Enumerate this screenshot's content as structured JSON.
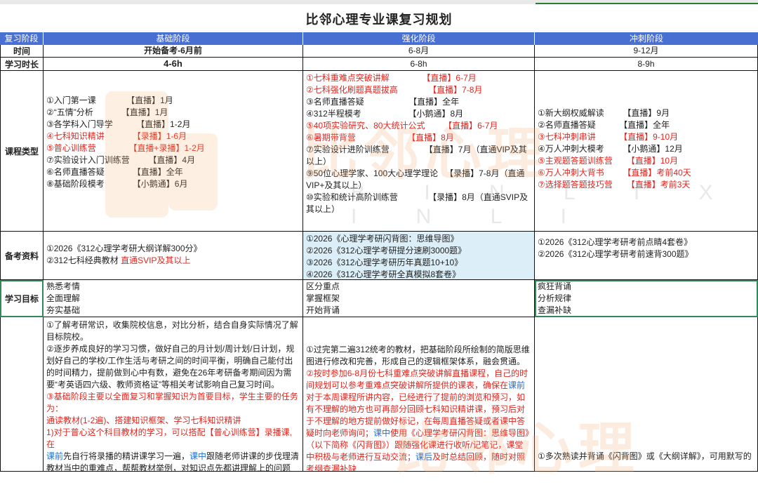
{
  "title": "比邻心理专业课复习规划",
  "headers": [
    "复习阶段",
    "基础阶段",
    "强化阶段",
    "冲刺阶段"
  ],
  "time_row": {
    "label": "时间",
    "values": [
      "开始备考-6月前",
      "6-8月",
      "9-12月"
    ]
  },
  "duration_row": {
    "label": "学习时长",
    "values": [
      "4-6h",
      "6-8h",
      "8-9h"
    ]
  },
  "course_row": {
    "label": "课程类型",
    "basic": [
      "①入门第一课             【直播】1月",
      "②“五情”分析            【直播】1月",
      "③各学科入门导学          【直播】1-2月",
      "④七科知识精讲            【录播】1-6月",
      "⑤普心训练营              【直播+录播】1-2月",
      "⑦实验设计入门训练营        【直播】4月",
      "⑥名师直播答疑            【直播】全年",
      "⑧基础阶段模考            【小鹅通】6月"
    ],
    "strengthen": [
      "①七科重难点突破讲解              【直播】6-7月",
      "②七科强化刷题真题拔高             【直播】7-8月",
      "③名师直播答疑                   【直播】全年",
      "④312半程模考                    【小鹅通】8月",
      "⑤40项实验研究、80大统计公式        【直播】6-7月",
      "⑥暑期带背营                      【直播】8月",
      "⑦实验设计进阶训练营               【直播】7月（直通VIP及其",
      "以上）",
      "⑨50位心理学家、100大心理学理论   【录播】7-8月（直通",
      "VIP+及其以上）",
      "⑩实验和统计高阶训练营             【录播】8月（直通SVIP及",
      "其以上）"
    ],
    "sprint": [
      "①新大纲权威解读        【直播】9月",
      "②名师直播答疑          【直播】全年",
      "③七科冲刺串讲          【直播】9-10月",
      "④万人冲刺大模考        【小鹅通】12月",
      "⑤主观题答题训练营      【直播】10月",
      "⑥万人冲刺大背书        【直播】考前40天",
      "⑦选择题答题技巧营      【直播】考前3天"
    ]
  },
  "material_row": {
    "label": "备考资料",
    "basic": [
      "①2026《312心理学考研大纲详解300分》",
      "②312七科经典教材 ",
      "直通SVIP及其以上"
    ],
    "strengthen": [
      "①2026《心理学考研闪背图：思维导图》",
      "②2026《312心理学考研提分速刷3000题》",
      "③2026《312心理学考研历年真题10+10》",
      "④2026《312心理学考研全真模拟8套卷》"
    ],
    "sprint": [
      "①2026《312心理学考研考前点睛4套卷》",
      "②2026《312心理学考研考前速背300题》"
    ]
  },
  "goal_row": {
    "label": "学习目标",
    "basic": [
      "熟悉考情",
      "全面理解",
      "夯实基础"
    ],
    "strengthen": [
      "区分重点",
      "掌握框架",
      "开始背诵"
    ],
    "sprint": [
      "疯狂背诵",
      "分析规律",
      "查漏补缺"
    ]
  },
  "plan_row": {
    "basic": {
      "p1": "①了解考研常识，收集院校信息，对比分析，结合自身实际情况了解目标院校。",
      "p2": "②逐步养成良好的学习习惯，做好自己的月计划/周计划/日计划，规划好自己的学校/工作生活与考研之间的时间平衡，明确自己能付出的时间精力，提前做到心中有数，避免在26年考研备考期间因为需要“考英语四六级、教师资格证”等相关考试影响自己复习时间。",
      "p3": "③基础阶段主要以全面复习和掌握知识为首要目标，学生主要的任务为：",
      "p4": "通读教材(1-2遍)、搭建知识框架、学习七科知识精讲",
      "p5a": "1)对于普心这个科目教材的学习，可以搭配【普心训练营】录播课,在",
      "p5b": "课前",
      "p5c": "先自行将录播的精讲课学习一遍，",
      "p5d": "课中",
      "p5e": "跟随老师讲课的步伐理清教材当中的重难点，帮帮教材举例，对知识点先都讲理解上的问题"
    },
    "strengthen": {
      "p1": "①过完第二遍312统考的教材，把基础阶段所绘制的简版思维图进行修改和完善，形成自己的逻辑框架体系，融会贯通。",
      "p2a": "②按时参加6-8月份七科重难点突破讲解直播课程，自己的时间规划可以参考重难点突破讲解所提供的课表，确保在",
      "p2b": "课前",
      "p2c": "对于本周课程所讲内容，已经进行了提前的浏览和预习，如有不理解的地方也可再部分回顾七科知识精讲课，预习后对于不理解的地方提前做好标记，在每周直播答疑或者课中答疑时向老师询问；",
      "p2d": "课中",
      "p2e": "使用《心理学考研闪背图：思维导图》（以下简称《闪背图》）跟随强化课进行收听/记笔记，课堂中积极与老师进行互动交流；",
      "p2f": "课后",
      "p2g": "及时总结回顾，随时对照考纲查漏补缺"
    },
    "sprint": {
      "p1": "①多次熟读并背诵《闪背图》或《大纲详解》，可用默写的"
    }
  },
  "watermark": {
    "text": "比邻心理",
    "sub": "B I N L I X I N L I"
  },
  "colors": {
    "header_bg": "#4a6fd3",
    "red": "#e0261f",
    "blue": "#1e6fd9",
    "light_blue": "#dceef7",
    "green": "#2e8b57"
  }
}
